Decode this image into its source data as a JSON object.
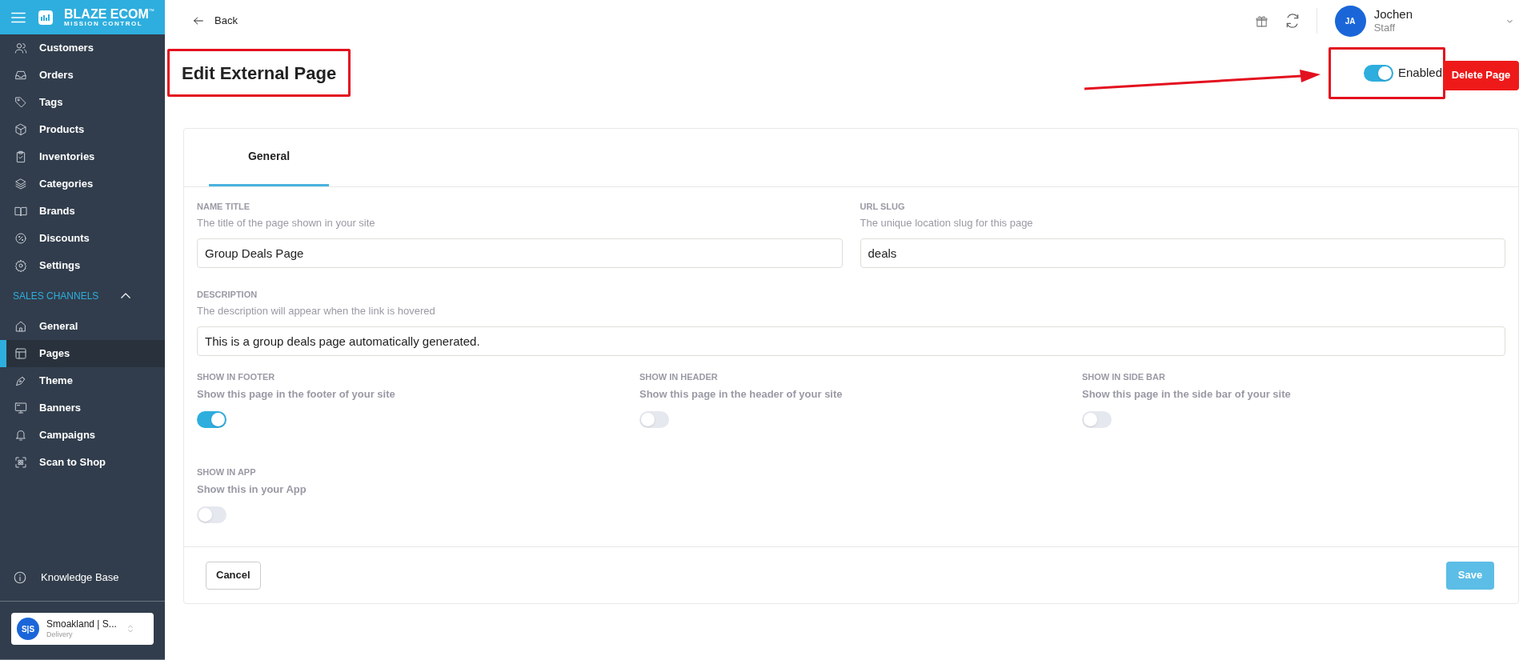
{
  "sidebar": {
    "brand": "BLAZE ECOM",
    "brand_mark": "™",
    "brand_tagline": "MISSION CONTROL",
    "items": [
      {
        "label": "Customers"
      },
      {
        "label": "Orders"
      },
      {
        "label": "Tags"
      },
      {
        "label": "Products"
      },
      {
        "label": "Inventories"
      },
      {
        "label": "Categories"
      },
      {
        "label": "Brands"
      },
      {
        "label": "Discounts"
      },
      {
        "label": "Settings"
      }
    ],
    "section": {
      "label": "SALES CHANNELS",
      "expanded": true
    },
    "channel_items": [
      {
        "label": "General",
        "selected": false
      },
      {
        "label": "Pages",
        "selected": true
      },
      {
        "label": "Theme",
        "selected": false
      },
      {
        "label": "Banners",
        "selected": false
      },
      {
        "label": "Campaigns",
        "selected": false
      },
      {
        "label": "Scan to Shop",
        "selected": false
      }
    ],
    "help": "Knowledge Base",
    "store": {
      "initials": "S|S",
      "name": "Smoakland | S...",
      "type": "Delivery"
    }
  },
  "header": {
    "back": "Back",
    "user": {
      "initials": "JA",
      "name": "Jochen",
      "role": "Staff"
    }
  },
  "page": {
    "title": "Edit External Page",
    "enabled": {
      "label": "Enabled",
      "on": true
    },
    "delete_button": "Delete Page"
  },
  "tabs": [
    {
      "label": "General",
      "selected": true
    }
  ],
  "fields": [
    {
      "label": "NAME TITLE",
      "hint": "The title of the page shown in your site",
      "value": "Group Deals Page"
    },
    {
      "label": "URL SLUG",
      "hint": "The unique location slug for this page",
      "value": "deals"
    },
    {
      "label": "DESCRIPTION",
      "hint": "The description will appear when the link is hovered",
      "value": "This is a group deals page automatically generated."
    }
  ],
  "toggles": [
    {
      "label": "SHOW IN FOOTER",
      "hint": "Show this page in the footer of your site",
      "on": true
    },
    {
      "label": "SHOW IN HEADER",
      "hint": "Show this page in the header of your site",
      "on": false
    },
    {
      "label": "SHOW IN SIDE BAR",
      "hint": "Show this page in the side bar of your site",
      "on": false
    },
    {
      "label": "SHOW IN APP",
      "hint": "Show this in your App",
      "on": false
    }
  ],
  "footer": {
    "cancel": "Cancel",
    "save": {
      "label": "Save",
      "disabled": true
    }
  }
}
